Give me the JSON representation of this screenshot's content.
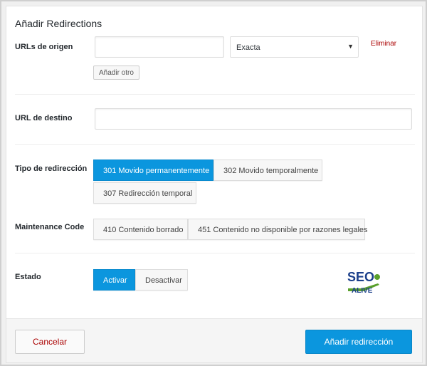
{
  "title": "Añadir Redirections",
  "source": {
    "label": "URLs de origen",
    "url_value": "",
    "match_type": "Exacta",
    "remove_label": "Eliminar",
    "add_another_label": "Añadir otro"
  },
  "destination": {
    "label": "URL de destino",
    "url_value": ""
  },
  "redirect_type": {
    "label": "Tipo de redirección",
    "options": [
      "301 Movido permanentemente",
      "302 Movido temporalmente",
      "307 Redirección temporal"
    ],
    "selected": "301 Movido permanentemente"
  },
  "maintenance": {
    "label": "Maintenance Code",
    "options": [
      "410 Contenido borrado",
      "451 Contenido no disponible por razones legales"
    ]
  },
  "status": {
    "label": "Estado",
    "options": [
      "Activar",
      "Desactivar"
    ],
    "selected": "Activar"
  },
  "logo": {
    "line1": "SEO",
    "line2": "ALIVE"
  },
  "footer": {
    "cancel_label": "Cancelar",
    "submit_label": "Añadir redirección"
  },
  "colors": {
    "accent": "#0b96de",
    "danger": "#aa0000",
    "logo_blue": "#1b3f8b",
    "logo_green": "#5aa02c"
  }
}
